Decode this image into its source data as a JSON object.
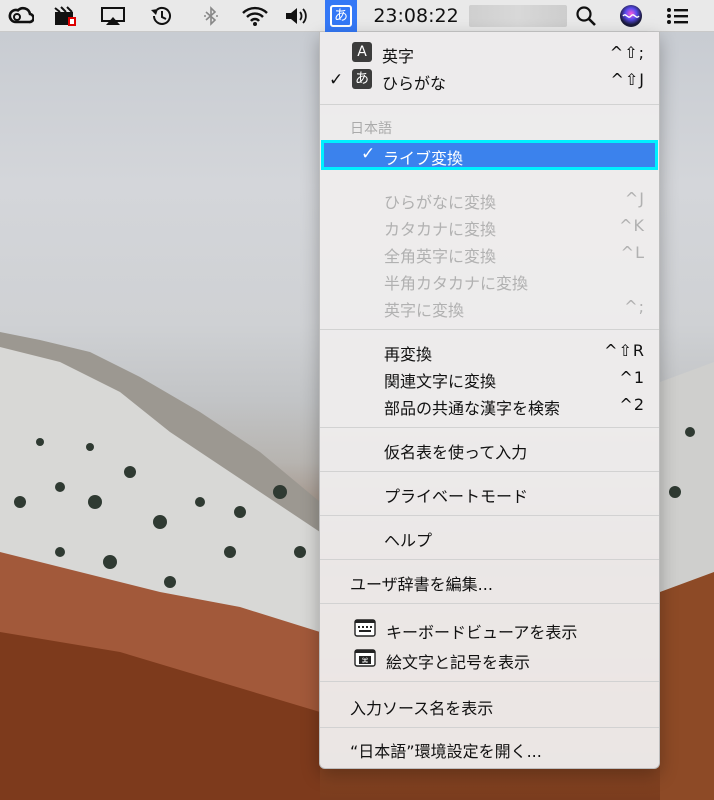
{
  "menubar": {
    "ime_glyph": "あ",
    "clock": "23:08:22",
    "icons": [
      "creative-cloud-icon",
      "video-recorder-icon",
      "airplay-icon",
      "time-machine-icon",
      "bluetooth-icon",
      "wifi-icon",
      "volume-icon",
      "input-method-icon",
      "spotlight-search-icon",
      "siri-icon",
      "notification-center-icon"
    ]
  },
  "menu": {
    "sources": [
      {
        "glyph": "A",
        "label": "英字",
        "shortcut": "^⇧;",
        "checked": false
      },
      {
        "glyph": "あ",
        "label": "ひらがな",
        "shortcut": "^⇧J",
        "checked": true
      }
    ],
    "section_header": "日本語",
    "live_conversion": {
      "check": "✓",
      "label": "ライブ変換"
    },
    "convert_items": [
      {
        "label": "ひらがなに変換",
        "shortcut": "^J"
      },
      {
        "label": "カタカナに変換",
        "shortcut": "^K"
      },
      {
        "label": "全角英字に変換",
        "shortcut": "^L"
      },
      {
        "label": "半角カタカナに変換",
        "shortcut": ""
      },
      {
        "label": "英字に変換",
        "shortcut": "^;"
      }
    ],
    "reconvert_items": [
      {
        "label": "再変換",
        "shortcut": "^⇧R"
      },
      {
        "label": "関連文字に変換",
        "shortcut": "^1"
      },
      {
        "label": "部品の共通な漢字を検索",
        "shortcut": "^2"
      }
    ],
    "kana_table": "仮名表を使って入力",
    "private_mode": "プライベートモード",
    "help": "ヘルプ",
    "user_dictionary": "ユーザ辞書を編集...",
    "keyboard_viewer": "キーボードビューアを表示",
    "emoji_symbols": "絵文字と記号を表示",
    "show_source_name": "入力ソース名を表示",
    "open_preferences": "“日本語”環境設定を開く..."
  }
}
